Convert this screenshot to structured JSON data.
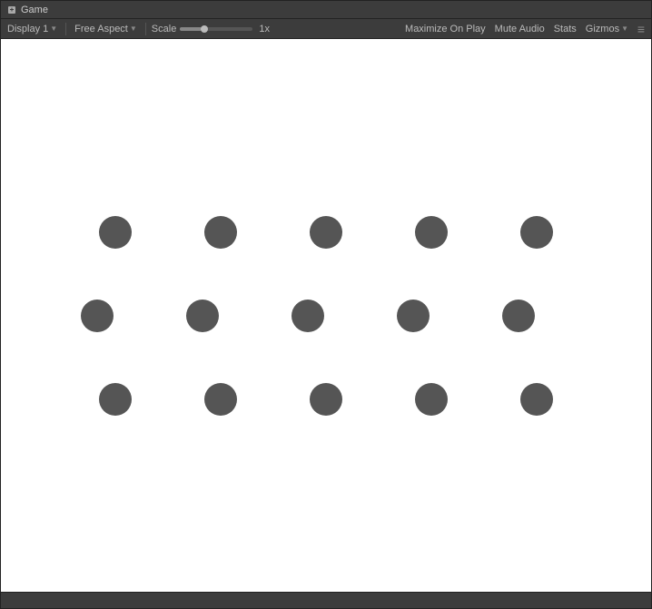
{
  "titleBar": {
    "icon": "game-icon",
    "title": "Game"
  },
  "toolbar": {
    "display": {
      "label": "Display 1",
      "arrow": "▼"
    },
    "aspect": {
      "label": "Free Aspect",
      "arrow": "▼"
    },
    "scale": {
      "label": "Scale",
      "value": "1x"
    },
    "maximize": {
      "label": "Maximize On Play"
    },
    "mute": {
      "label": "Mute Audio"
    },
    "stats": {
      "label": "Stats"
    },
    "gizmos": {
      "label": "Gizmos",
      "arrow": "▼"
    },
    "menu": "≡"
  },
  "dots": {
    "rows": [
      [
        true,
        false,
        true,
        false,
        true,
        false,
        true,
        false,
        true
      ],
      [
        true,
        false,
        true,
        false,
        true,
        false,
        true,
        false,
        true
      ],
      [
        true,
        false,
        true,
        false,
        true,
        false,
        true,
        false,
        true
      ]
    ],
    "color": "#555555",
    "size": 36
  }
}
